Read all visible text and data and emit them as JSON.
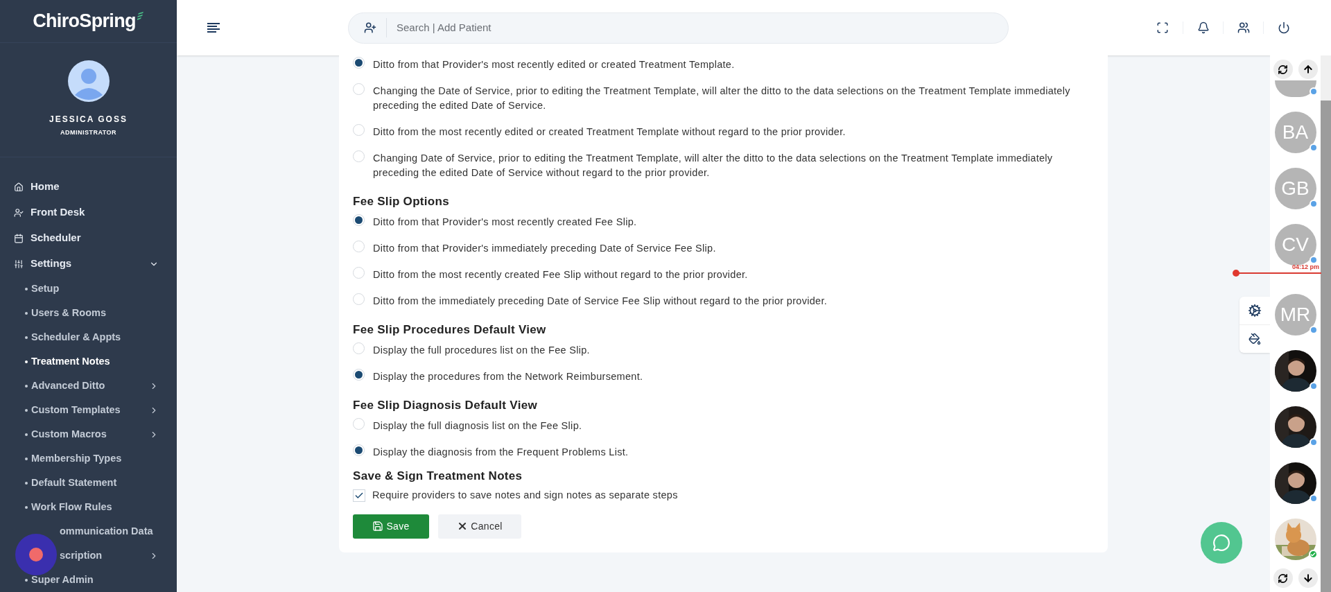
{
  "brand": "ChiroSpring",
  "user": {
    "name": "JESSICA GOSS",
    "role": "ADMINISTRATOR"
  },
  "nav": [
    {
      "label": "Home"
    },
    {
      "label": "Front Desk"
    },
    {
      "label": "Scheduler"
    },
    {
      "label": "Settings",
      "expanded": true,
      "children": [
        {
          "label": "Setup",
          "selected": false,
          "submenu": false,
          "obscured": false
        },
        {
          "label": "Users & Rooms",
          "selected": false,
          "submenu": false,
          "obscured": false
        },
        {
          "label": "Scheduler & Appts",
          "selected": false,
          "submenu": false,
          "obscured": false
        },
        {
          "label": "Treatment Notes",
          "selected": true,
          "submenu": false,
          "obscured": false
        },
        {
          "label": "Advanced Ditto",
          "selected": false,
          "submenu": true,
          "obscured": false
        },
        {
          "label": "Custom Templates",
          "selected": false,
          "submenu": true,
          "obscured": false
        },
        {
          "label": "Custom Macros",
          "selected": false,
          "submenu": true,
          "obscured": false
        },
        {
          "label": "Membership Types",
          "selected": false,
          "submenu": false,
          "obscured": false
        },
        {
          "label": "Default Statement",
          "selected": false,
          "submenu": false,
          "obscured": false
        },
        {
          "label": "Work Flow Rules",
          "selected": false,
          "submenu": false,
          "obscured": false
        },
        {
          "label": "ommunication Data",
          "selected": false,
          "submenu": false,
          "obscured": true
        },
        {
          "label": "scription",
          "selected": false,
          "submenu": true,
          "obscured": true
        },
        {
          "label": "Super Admin",
          "selected": false,
          "submenu": false,
          "obscured": false
        }
      ]
    }
  ],
  "search": {
    "placeholder": "Search | Add Patient"
  },
  "sections": [
    {
      "options": [
        {
          "label": "Ditto from that Provider's most recently edited or created Treatment Template.",
          "selected": true
        },
        {
          "label": " Changing the Date of Service, prior to editing the Treatment Template, will alter the ditto to the data selections on the Treatment Template immediately preceding the edited Date of Service.",
          "selected": false
        },
        {
          "label": "Ditto from the most recently edited or created Treatment Template without regard to the prior provider.",
          "selected": false
        },
        {
          "label": " Changing Date of Service, prior to editing the Treatment Template, will alter the ditto to the data selections on the Treatment Template immediately preceding the edited Date of Service without regard to the prior provider.",
          "selected": false
        }
      ]
    },
    {
      "title": "Fee Slip Options",
      "options": [
        {
          "label": "Ditto from that Provider's most recently created Fee Slip.",
          "selected": true
        },
        {
          "label": "Ditto from that Provider's immediately preceding Date of Service Fee Slip.",
          "selected": false
        },
        {
          "label": "Ditto from the most recently created Fee Slip without regard to the prior provider.",
          "selected": false
        },
        {
          "label": "Ditto from the immediately preceding Date of Service Fee Slip without regard to the prior provider.",
          "selected": false
        }
      ]
    },
    {
      "title": "Fee Slip Procedures Default View",
      "options": [
        {
          "label": "Display the full procedures list on the Fee Slip.",
          "selected": false
        },
        {
          "label": "Display the procedures from the Network Reimbursement.",
          "selected": true
        }
      ]
    },
    {
      "title": "Fee Slip Diagnosis Default View",
      "options": [
        {
          "label": "Display the full diagnosis list on the Fee Slip.",
          "selected": false
        },
        {
          "label": "Display the diagnosis from the Frequent Problems List.",
          "selected": true
        }
      ]
    }
  ],
  "save_sign": {
    "title": "Save & Sign Treatment Notes",
    "checkbox": {
      "label": "Require providers to save notes and sign notes as separate steps",
      "checked": true
    }
  },
  "buttons": [
    {
      "label": "Save",
      "kind": "primary"
    },
    {
      "label": "Cancel",
      "kind": "secondary"
    }
  ],
  "rail": {
    "avatars": [
      {
        "kind": "partial",
        "color": "#5aa2e6"
      },
      {
        "kind": "initials",
        "initials": "BA",
        "color": "#5aa2e6"
      },
      {
        "kind": "initials",
        "initials": "GB",
        "color": "#5aa2e6"
      },
      {
        "kind": "initials",
        "initials": "CV",
        "color": "#5aa2e6"
      },
      {
        "kind": "marker",
        "time": "04:12 pm"
      },
      {
        "kind": "initials",
        "initials": "MR",
        "color": "#5aa2e6"
      },
      {
        "kind": "picture",
        "color": "#5aa2e6"
      },
      {
        "kind": "picture",
        "color": "#5aa2e6"
      },
      {
        "kind": "picture",
        "color": "#5aa2e6"
      },
      {
        "kind": "pet",
        "color": "#22b04b"
      }
    ]
  }
}
